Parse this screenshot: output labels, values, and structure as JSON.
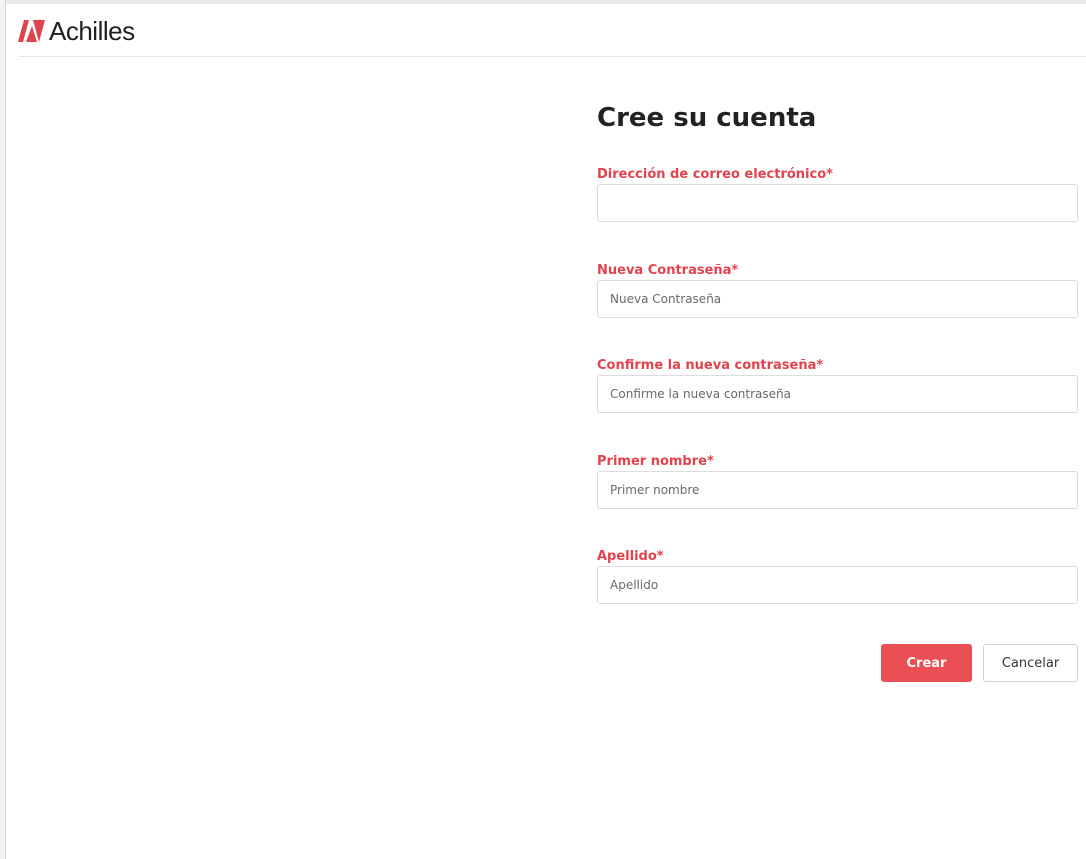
{
  "brand": {
    "name": "Achilles",
    "color": "#e0434d"
  },
  "form": {
    "title": "Cree su cuenta",
    "fields": [
      {
        "label": "Dirección de correo electrónico*",
        "value": "",
        "placeholder": ""
      },
      {
        "label": "Nueva Contraseña*",
        "value": "",
        "placeholder": "Nueva Contraseña"
      },
      {
        "label": "Confirme la nueva contraseña*",
        "value": "",
        "placeholder": "Confirme la nueva contraseña"
      },
      {
        "label": "Primer nombre*",
        "value": "",
        "placeholder": "Primer nombre"
      },
      {
        "label": "Apellido*",
        "value": "",
        "placeholder": "Apellido"
      }
    ],
    "create_label": "Crear",
    "cancel_label": "Cancelar"
  },
  "icons": {
    "logo": "achilles-logo-icon"
  },
  "colors": {
    "label": "#e0434d",
    "primary_button": "#ea4f55",
    "input_border": "#dcdcdc"
  }
}
